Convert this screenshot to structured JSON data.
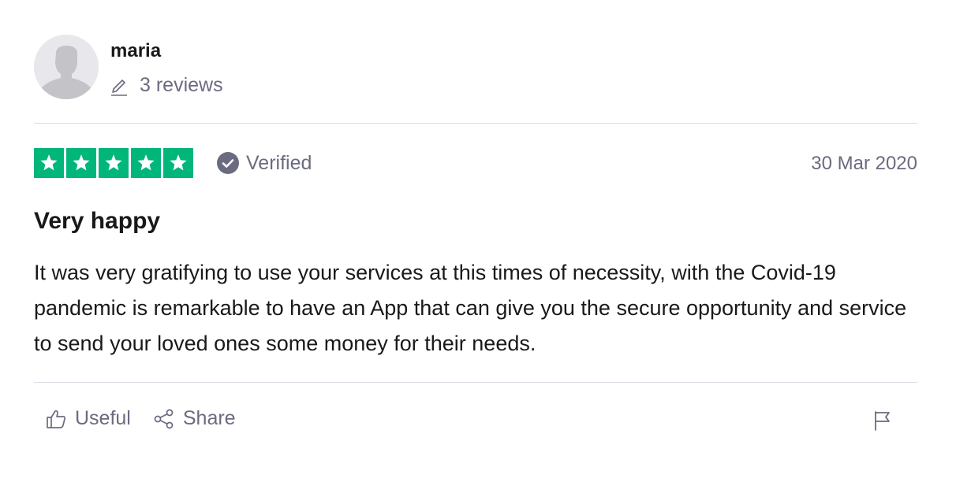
{
  "consumer": {
    "name": "maria",
    "reviews_count": "3 reviews",
    "avatar_icon": "person-silhouette-icon"
  },
  "review": {
    "rating": 5,
    "rating_max": 5,
    "verified_label": "Verified",
    "date": "30 Mar 2020",
    "title": "Very happy",
    "text": "It was very gratifying to use your services at this times of necessity, with the Covid-19 pandemic is remarkable to have an App that can give you the secure opportunity and service to send your loved ones some money for their needs."
  },
  "actions": {
    "useful_label": "Useful",
    "share_label": "Share"
  },
  "colors": {
    "star_green": "#00b67a",
    "muted_text": "#6b6b80",
    "body_text": "#191919"
  }
}
